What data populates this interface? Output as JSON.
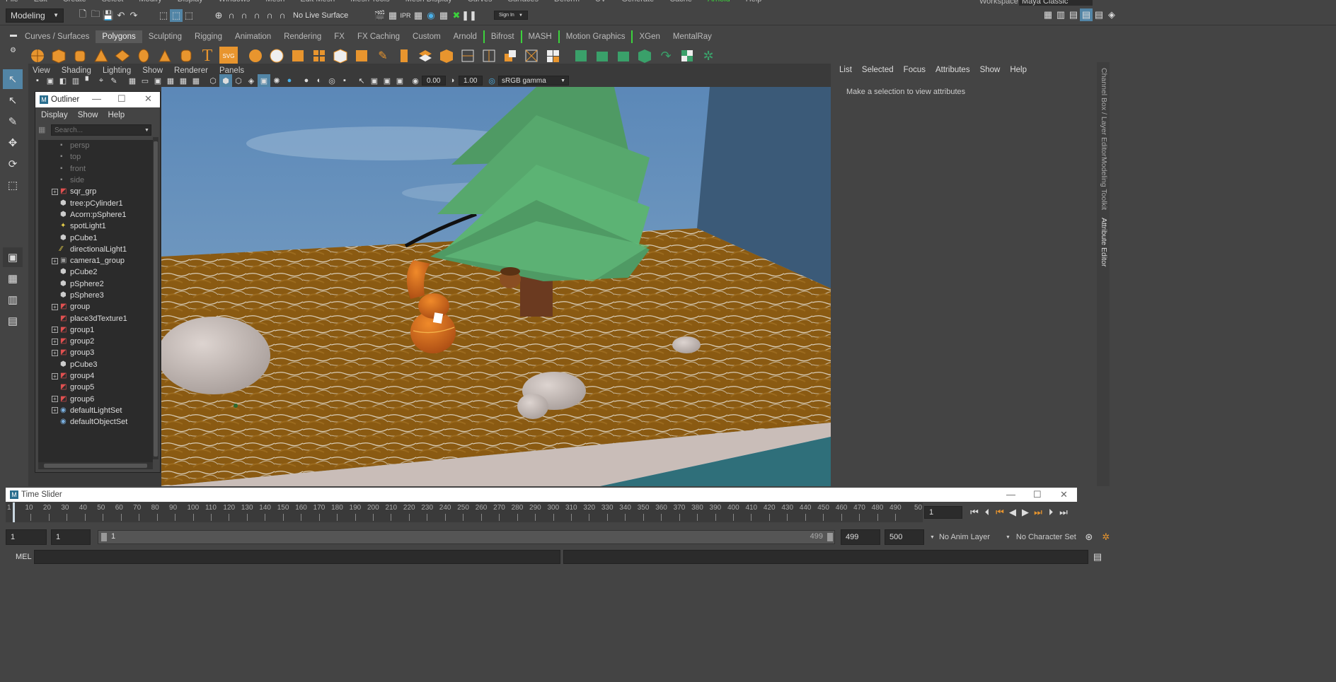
{
  "menubar": [
    "File",
    "Edit",
    "Create",
    "Select",
    "Modify",
    "Display",
    "Windows",
    "Mesh",
    "Edit Mesh",
    "Mesh Tools",
    "Mesh Display",
    "Curves",
    "Surfaces",
    "Deform",
    "UV",
    "Generate",
    "Cache",
    "Arnold",
    "Help"
  ],
  "workspace": {
    "label": "Workspace :",
    "value": "Maya Classic"
  },
  "status": {
    "mode": "Modeling",
    "live_surface": "No Live Surface",
    "sign_in": "Sign In"
  },
  "shelf_tabs": [
    "Curves / Surfaces",
    "Polygons",
    "Sculpting",
    "Rigging",
    "Animation",
    "Rendering",
    "FX",
    "FX Caching",
    "Custom",
    "Arnold",
    "Bifrost",
    "MASH",
    "Motion Graphics",
    "XGen",
    "MentalRay"
  ],
  "shelf_active": "Polygons",
  "viewport": {
    "menus": [
      "View",
      "Shading",
      "Lighting",
      "Show",
      "Renderer",
      "Panels"
    ],
    "exposure": "0.00",
    "gamma": "1.00",
    "colorspace": "sRGB gamma"
  },
  "outliner": {
    "title": "Outliner",
    "menus": [
      "Display",
      "Show",
      "Help"
    ],
    "search_placeholder": "Search...",
    "items": [
      {
        "label": "persp",
        "icon": "camera-icon",
        "expand": false,
        "dim": true
      },
      {
        "label": "top",
        "icon": "camera-icon",
        "expand": false,
        "dim": true
      },
      {
        "label": "front",
        "icon": "camera-icon",
        "expand": false,
        "dim": true
      },
      {
        "label": "side",
        "icon": "camera-icon",
        "expand": false,
        "dim": true
      },
      {
        "label": "sqr_grp",
        "icon": "group-icon",
        "expand": true,
        "dim": false
      },
      {
        "label": "tree:pCylinder1",
        "icon": "mesh-icon",
        "expand": false,
        "dim": false
      },
      {
        "label": "Acorn:pSphere1",
        "icon": "mesh-icon",
        "expand": false,
        "dim": false
      },
      {
        "label": "spotLight1",
        "icon": "spotlight-icon",
        "expand": false,
        "dim": false
      },
      {
        "label": "pCube1",
        "icon": "mesh-icon",
        "expand": false,
        "dim": false
      },
      {
        "label": "directionalLight1",
        "icon": "dirlight-icon",
        "expand": false,
        "dim": false
      },
      {
        "label": "camera1_group",
        "icon": "camera-group-icon",
        "expand": true,
        "dim": false
      },
      {
        "label": "pCube2",
        "icon": "mesh-icon",
        "expand": false,
        "dim": false
      },
      {
        "label": "pSphere2",
        "icon": "mesh-icon",
        "expand": false,
        "dim": false
      },
      {
        "label": "pSphere3",
        "icon": "mesh-icon",
        "expand": false,
        "dim": false
      },
      {
        "label": "group",
        "icon": "group-icon",
        "expand": true,
        "dim": false
      },
      {
        "label": "place3dTexture1",
        "icon": "texture-icon",
        "expand": false,
        "dim": false
      },
      {
        "label": "group1",
        "icon": "group-icon",
        "expand": true,
        "dim": false
      },
      {
        "label": "group2",
        "icon": "group-icon",
        "expand": true,
        "dim": false
      },
      {
        "label": "group3",
        "icon": "group-icon",
        "expand": true,
        "dim": false
      },
      {
        "label": "pCube3",
        "icon": "mesh-icon",
        "expand": false,
        "dim": false
      },
      {
        "label": "group4",
        "icon": "group-icon",
        "expand": true,
        "dim": false
      },
      {
        "label": "group5",
        "icon": "group-icon",
        "expand": false,
        "dim": false
      },
      {
        "label": "group6",
        "icon": "group-icon",
        "expand": true,
        "dim": false
      },
      {
        "label": "defaultLightSet",
        "icon": "set-icon",
        "expand": true,
        "dim": false
      },
      {
        "label": "defaultObjectSet",
        "icon": "set-icon",
        "expand": false,
        "dim": false
      }
    ]
  },
  "attribute_editor": {
    "menus": [
      "List",
      "Selected",
      "Focus",
      "Attributes",
      "Show",
      "Help"
    ],
    "message": "Make a selection to view attributes",
    "side_tabs": [
      "Channel Box / Layer Editor",
      "Modeling Toolkit",
      "Attribute Editor"
    ]
  },
  "time_slider": {
    "title": "Time Slider",
    "ticks": [
      "1",
      "10",
      "20",
      "30",
      "40",
      "50",
      "60",
      "70",
      "80",
      "90",
      "100",
      "110",
      "120",
      "130",
      "140",
      "150",
      "160",
      "170",
      "180",
      "190",
      "200",
      "210",
      "220",
      "230",
      "240",
      "250",
      "260",
      "270",
      "280",
      "290",
      "300",
      "310",
      "320",
      "330",
      "340",
      "350",
      "360",
      "370",
      "380",
      "390",
      "400",
      "410",
      "420",
      "430",
      "440",
      "450",
      "460",
      "470",
      "480",
      "490"
    ],
    "last_tick": "50",
    "current_frame": "1"
  },
  "range": {
    "start": "1",
    "playback_start": "1",
    "slider_start": "1",
    "slider_end": "499",
    "playback_end": "499",
    "end": "500",
    "anim_layer": "No Anim Layer",
    "character_set": "No Character Set"
  },
  "command_line": {
    "label": "MEL"
  },
  "colors": {
    "accent": "#5285a6",
    "arnold": "#3cd23c",
    "icon_orange": "#e8952e"
  }
}
